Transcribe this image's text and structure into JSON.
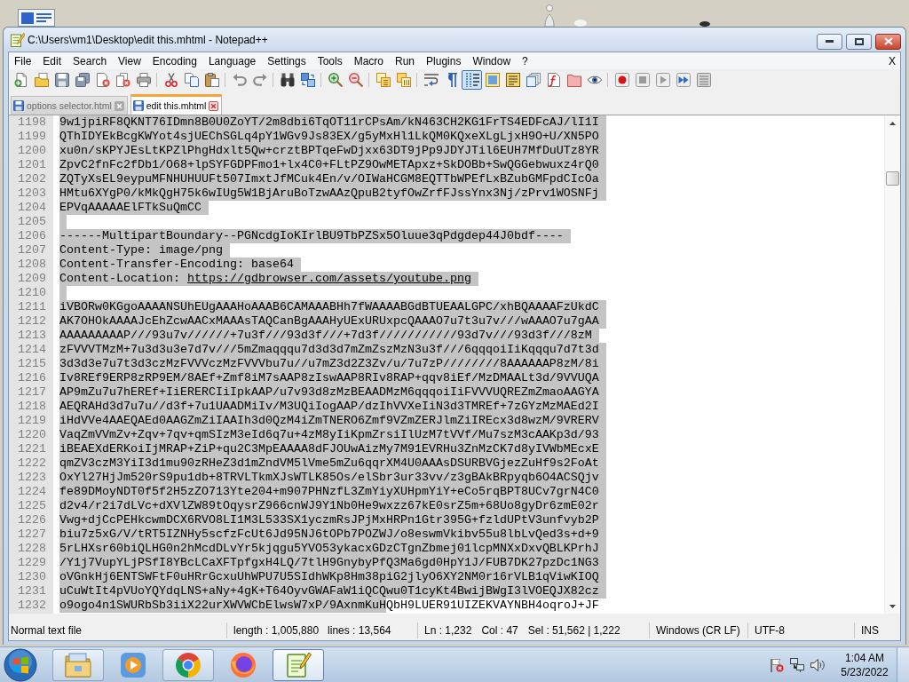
{
  "window": {
    "title": "C:\\Users\\vm1\\Desktop\\edit this.mhtml - Notepad++"
  },
  "menu": {
    "items": [
      "File",
      "Edit",
      "Search",
      "View",
      "Encoding",
      "Language",
      "Settings",
      "Tools",
      "Macro",
      "Run",
      "Plugins",
      "Window",
      "?"
    ],
    "close_document": "X"
  },
  "toolbar": [
    {
      "on": false
    },
    {
      "on": false
    },
    {
      "on": false
    },
    {
      "on": false
    },
    {
      "on": false
    },
    {
      "on": false
    },
    {
      "on": false
    },
    {
      "on": false
    },
    {
      "on": false
    },
    {
      "on": false
    },
    {
      "on": false
    },
    {
      "on": false
    },
    {
      "on": false
    },
    {
      "on": false
    },
    {
      "on": false
    },
    {
      "on": false
    },
    {
      "on": false
    },
    {
      "on": false
    },
    {
      "on": false
    },
    {
      "on": false
    },
    {
      "on": true
    },
    {
      "on": false
    },
    {
      "on": false
    },
    {
      "on": false
    },
    {
      "on": false
    },
    {
      "on": false
    },
    {
      "on": false
    },
    {
      "on": false
    },
    {
      "on": false
    },
    {
      "on": false
    },
    {
      "on": false
    },
    {
      "on": false
    }
  ],
  "tabs": [
    {
      "label": "options selector.html",
      "selected": false
    },
    {
      "label": "edit this.mhtml",
      "selected": true
    }
  ],
  "editor": {
    "lines": [
      {
        "number": "1198",
        "text": "9w1jpiRF8QKNT76IDmn8B0U0ZoYT/2m8dbi6TqOT11rCPsAm/kN463CH2KG1FrTS4EDFcAJ/lI1I",
        "selected": true
      },
      {
        "number": "1199",
        "text": "QThIDYEkBcgKWYot4sjUEChSGLq4pY1WGv9Js83EX/g5yMxHl1LkQM0KQxeXLgLjxH9O+U/XN5PO",
        "selected": true
      },
      {
        "number": "1200",
        "text": "xu0n/sKPYJEsLtKPZlPhgHdxlt5Qw+crztBPTqeFwDjxx63DT9jPp9JDYJTil6EUH7MfDuUTz8YR",
        "selected": true
      },
      {
        "number": "1201",
        "text": "ZpvC2fnFc2fDb1/O68+lpSYFGDPFmo1+lx4C0+FLtPZ9OwMETApxz+SkDOBb+SwQGGebwuxz4rQ0",
        "selected": true
      },
      {
        "number": "1202",
        "text": "ZQTyXsEL9eypuMFNHUHUUFt507ImxtJfMCuk4En/v/OIWaHCGM8EQTTbWPEfLxBZubGMFpdCIcOa",
        "selected": true
      },
      {
        "number": "1203",
        "text": "HMtu6XYgP0/kMkQgH75k6wIUg5W1BjAruBoTzwAAzQpuB2tyfOwZrfFJssYnx3Nj/zPrv1WOSNFj",
        "selected": true
      },
      {
        "number": "1204",
        "text": "EPVqAAAAAElFTkSuQmCC",
        "selected": true
      },
      {
        "number": "1205",
        "selected": true
      },
      {
        "number": "1206",
        "text": "------MultipartBoundary--PGNcdgIoKIrlBU9TbPZSx5Oluue3qPdgdep44J0bdf----",
        "selected": true
      },
      {
        "number": "1207",
        "text": "Content-Type: image/png",
        "selected": true
      },
      {
        "number": "1208",
        "text": "Content-Transfer-Encoding: base64",
        "selected": true
      },
      {
        "number": "1209",
        "text": "Content-Location: ",
        "link": "https://gdbrowser.com/assets/youtube.png",
        "selected": true
      },
      {
        "number": "1210",
        "selected": true
      },
      {
        "number": "1211",
        "text": "iVBORw0KGgoAAAANSUhEUgAAAHoAAAB6CAMAAABHh7fWAAAABGdBTUEAALGPC/xhBQAAAAFzUkdC",
        "selected": true
      },
      {
        "number": "1212",
        "text": "AK7OHOkAAAAJcEhZcwAACxMAAAsTAQCanBgAAAHyUExURUxpcQAAAO7u7t3u7v///wAAAO7u7gAA",
        "selected": true
      },
      {
        "number": "1213",
        "text": "AAAAAAAAAP///93u7v//////+7u3f///93d3f///+7d3f///////////93d7v///93d3f///8zM",
        "selected": true
      },
      {
        "number": "1214",
        "text": "zFVVVTMzM+7u3d3u3e7d7v///5mZmaqqqu7d3d3d7mZmZszMzN3u3f///6qqqoiIiKqqqu7d7t3d",
        "selected": true
      },
      {
        "number": "1215",
        "text": "3d3d3e7u7t3d3czMzFVVVczMzFVVVbu7u//u7mZ3d2Z3Zv/u/7u7zP////////8AAAAAAP8zM/8i",
        "selected": true
      },
      {
        "number": "1216",
        "text": "Iv8REf9ERP8zRP9EM/8AEf+Zmf8iM7sAAP8zIswAAP8RIv8RAP+qqv8iEf/MzDMAALt3d/9VVUQA",
        "selected": true
      },
      {
        "number": "1217",
        "text": "AP9mZu7u7hEREf+IiERERCIiIpkAAP/u7v93d8zMzBEAADMzM6qqqoiIiFVVVUQREZmZmaoAAGYA",
        "selected": true
      },
      {
        "number": "1218",
        "text": "AEQRAHd3d7u7u//d3f+7u1UAADMiIv/M3UQiIogAAP/dzIhVVXeIiN3d3TMREf+7zGYzMzMAEd2I",
        "selected": true
      },
      {
        "number": "1219",
        "text": "iHdVVe4AAEQAEd0AAGZmZiIAAIh3d0QzM4iZmTNERO6Zmf9VZmZERJlmZiIREcx3d8wzM/9VRERV",
        "selected": true
      },
      {
        "number": "1220",
        "text": "VaqZmVVmZv+Zqv+7qv+qmSIzM3eId6q7u+4zM8yIiKpmZrsiIlUzM7tVVf/Mu7szM3cAAKp3d/93",
        "selected": true
      },
      {
        "number": "1221",
        "text": "iBEAEXdERKoiIjMRAP+ZiP+qu2C3MpEAAAA8dFJOUwAizMy7M91EVRHu3ZnMzCK7d8yIVWbMEcxE",
        "selected": true
      },
      {
        "number": "1222",
        "text": "qmZV3czM3YiI3d1mu90zRHeZ3d1mZndVM5lVme5mZu6qqrXM4U0AAAsDSURBVGjezZuHf9s2FoAt",
        "selected": true
      },
      {
        "number": "1223",
        "text": "OxYl27HjJm520rS9pu1db+8TRVLTkmXJsWTLK85Os/elSbr3ur33vv/z3gBAkBRpyqb6O4ACSQjv",
        "selected": true
      },
      {
        "number": "1224",
        "text": "fe89DMoyNDT0f5f2H5zZO713Yte204+m907PHNzfL3ZmYiyXUHpmYiY+eCo5rqBPT8UCv7grN4C0",
        "selected": true
      },
      {
        "number": "1225",
        "text": "d2v4/r2i7dLVc+dXVlZW89tOqysrZ966cnWJ9Y1Nb0He9wxzz67kE0srZ5m+68Uo8gyDr6zmE02r",
        "selected": true
      },
      {
        "number": "1226",
        "text": "Vwg+djCcPEHkcwmDCX6RVO8LI1M3L533SX1yczmRsJPjMxHRPn1Gtr395G+fzldUPtV3unfvyb2P",
        "selected": true
      },
      {
        "number": "1227",
        "text": "biu7z5xG/V/tRT5IZNHy5scfzFcUt6Jd95NJ6tOPb7POZWJ/o8eswmVkibv55u8lbLvQed3s+d+9",
        "selected": true
      },
      {
        "number": "1228",
        "text": "5rLHXsr60biQLHG0n2hMcdDLvYr5kjqgu5YVO53ykacxGDzCTgnZbmej01lcpMNXxDxvQBLKPrhJ",
        "selected": true
      },
      {
        "number": "1229",
        "text": "/Y1j7VupYLjPSfI8YBcLCaXFTpfgxH4LQ/7tlH9GnybyPfQ3Ma6gd0HpY1J/FUB7DK27pzDc1NG3",
        "selected": true
      },
      {
        "number": "1230",
        "text": "oVGnkHj6ENTSWFtF0uHRrGcxuUhWPU7U5SIdhWKp8Hm38piG2jlyO6XY2NM0r16rVLB1qViwKIOQ",
        "selected": true
      },
      {
        "number": "1231",
        "text": "uCuWtIt4pVUoYQYdqLNS+aNy+4gK+T64OyvGWAFaW1iQCQwu0T1cyKt4BwijBWgI3lVOEQJX82cz",
        "selected": true
      },
      {
        "number": "1232",
        "text": "o9ogo4n1SWURbSb3iiX22urXWVWCbElwsW7xP/9AxnmKuH",
        "unselected_tail": "QbH9LUER91UIZEKVAYNBH4oqroJ+JF",
        "selected": true
      }
    ]
  },
  "status_bar": {
    "file_type": "Normal text file",
    "length": "length : 1,005,880",
    "lines": "lines : 13,564",
    "line": "Ln : 1,232",
    "column": "Col : 47",
    "selection": "Sel : 51,562 | 1,222",
    "eol": "Windows (CR LF)",
    "encoding": "UTF-8",
    "mode": "INS"
  },
  "taskbar": {
    "apps": [
      {
        "running": true,
        "selected": false
      },
      {
        "running": false,
        "selected": false
      },
      {
        "running": true,
        "selected": false
      },
      {
        "running": false,
        "selected": false
      },
      {
        "running": true,
        "selected": true
      }
    ],
    "clock": {
      "time": "1:04 AM",
      "date": "5/23/2022"
    }
  }
}
